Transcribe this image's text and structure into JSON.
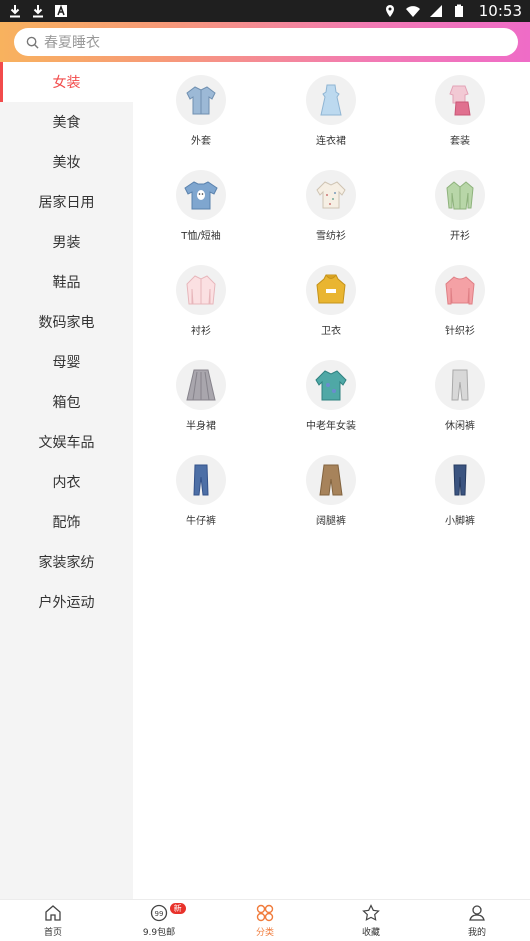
{
  "status_bar": {
    "time": "10:53"
  },
  "search": {
    "placeholder": "春夏睡衣"
  },
  "categories": [
    {
      "label": "女装"
    },
    {
      "label": "美食"
    },
    {
      "label": "美妆"
    },
    {
      "label": "居家日用"
    },
    {
      "label": "男装"
    },
    {
      "label": "鞋品"
    },
    {
      "label": "数码家电"
    },
    {
      "label": "母婴"
    },
    {
      "label": "箱包"
    },
    {
      "label": "文娱车品"
    },
    {
      "label": "内衣"
    },
    {
      "label": "配饰"
    },
    {
      "label": "家装家纺"
    },
    {
      "label": "户外运动"
    }
  ],
  "products": [
    {
      "label": "外套",
      "icon": "denim-jacket-icon"
    },
    {
      "label": "连衣裙",
      "icon": "dress-icon"
    },
    {
      "label": "套装",
      "icon": "outfit-set-icon"
    },
    {
      "label": "T恤/短袖",
      "icon": "tshirt-icon"
    },
    {
      "label": "雪纺衫",
      "icon": "chiffon-blouse-icon"
    },
    {
      "label": "开衫",
      "icon": "cardigan-icon"
    },
    {
      "label": "衬衫",
      "icon": "shirt-icon"
    },
    {
      "label": "卫衣",
      "icon": "hoodie-icon"
    },
    {
      "label": "针织衫",
      "icon": "knit-sweater-icon"
    },
    {
      "label": "半身裙",
      "icon": "skirt-icon"
    },
    {
      "label": "中老年女装",
      "icon": "tunic-icon"
    },
    {
      "label": "休闲裤",
      "icon": "casual-pants-icon"
    },
    {
      "label": "牛仔裤",
      "icon": "jeans-icon"
    },
    {
      "label": "阔腿裤",
      "icon": "wide-leg-pants-icon"
    },
    {
      "label": "小脚裤",
      "icon": "skinny-pants-icon"
    }
  ],
  "tabs": [
    {
      "label": "首页",
      "icon": "home-icon"
    },
    {
      "label": "9.9包邮",
      "icon": "nine-nine-icon",
      "badge": "新"
    },
    {
      "label": "分类",
      "icon": "category-icon"
    },
    {
      "label": "收藏",
      "icon": "star-icon"
    },
    {
      "label": "我的",
      "icon": "profile-icon"
    }
  ],
  "colors": {
    "accent": "#f24b4b",
    "tab_active": "#f07b3b",
    "badge": "#e8322b"
  }
}
